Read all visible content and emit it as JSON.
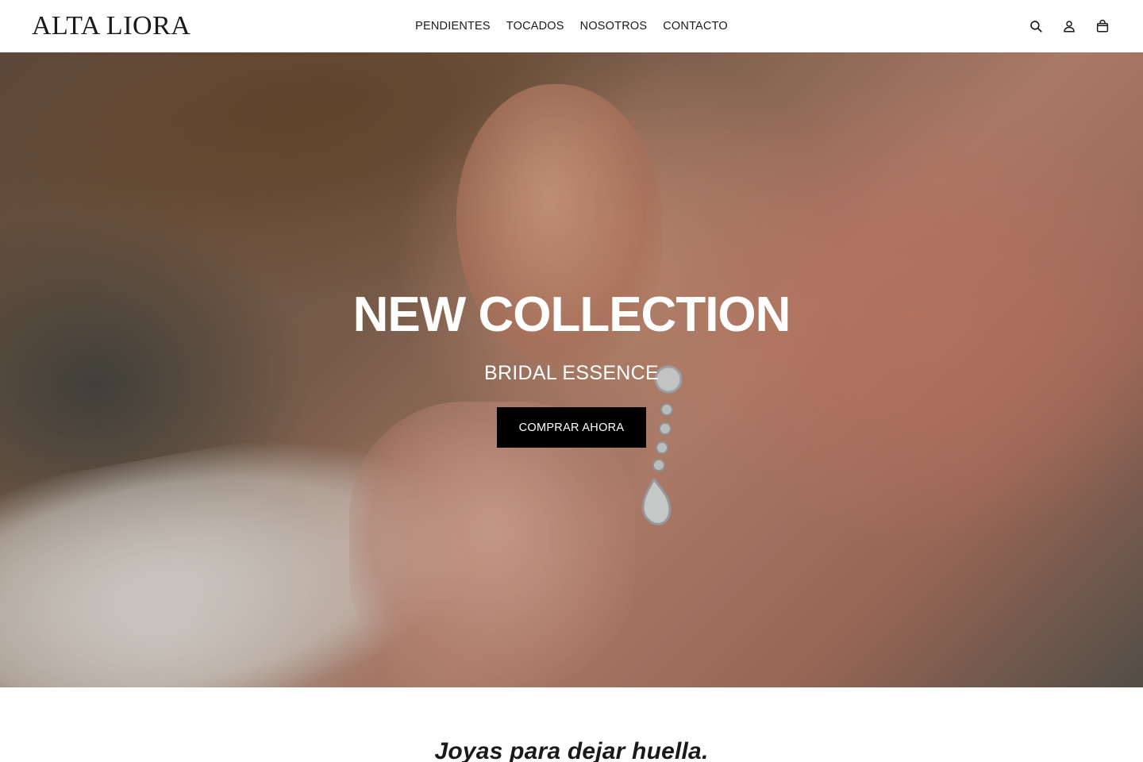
{
  "header": {
    "logo": "ALTA LIORA",
    "nav": [
      {
        "label": "PENDIENTES"
      },
      {
        "label": "TOCADOS"
      },
      {
        "label": "NOSOTROS"
      },
      {
        "label": "CONTACTO"
      }
    ],
    "icons": {
      "search": "search-icon",
      "account": "user-icon",
      "cart": "shopping-bag-icon"
    }
  },
  "hero": {
    "title": "NEW COLLECTION",
    "subtitle": "BRIDAL ESSENCE",
    "cta_label": "COMPRAR AHORA",
    "image_subject": "woman-ear-drop-earring-photo"
  },
  "tagline": {
    "text": "Joyas para dejar huella."
  },
  "colors": {
    "text": "#1a1a1a",
    "background": "#ffffff",
    "cta_background": "#000000",
    "hero_text": "#ffffff"
  }
}
